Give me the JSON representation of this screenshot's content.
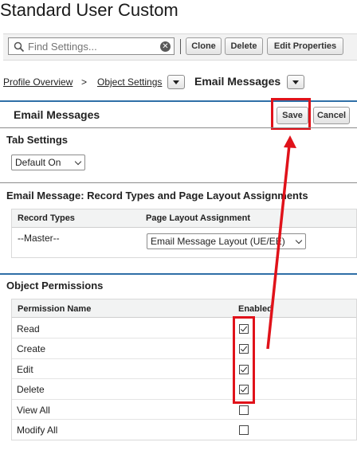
{
  "page_title": "Standard User Custom",
  "toolbar": {
    "search_placeholder": "Find Settings...",
    "clone_label": "Clone",
    "delete_label": "Delete",
    "edit_properties_label": "Edit Properties"
  },
  "breadcrumb": {
    "profile_overview": "Profile Overview",
    "separator": ">",
    "object_settings": "Object Settings",
    "current": "Email Messages"
  },
  "header": {
    "title": "Email Messages",
    "save_label": "Save",
    "cancel_label": "Cancel"
  },
  "tab_settings": {
    "title": "Tab Settings",
    "selected": "Default On"
  },
  "record_types": {
    "title": "Email Message: Record Types and Page Layout Assignments",
    "col_record_types": "Record Types",
    "col_page_layout": "Page Layout Assignment",
    "row_record_type": "--Master--",
    "row_layout": "Email Message Layout (UE/EE)"
  },
  "object_permissions": {
    "title": "Object Permissions",
    "col_permission": "Permission Name",
    "col_enabled": "Enabled",
    "rows": [
      {
        "name": "Read",
        "enabled": true
      },
      {
        "name": "Create",
        "enabled": true
      },
      {
        "name": "Edit",
        "enabled": true
      },
      {
        "name": "Delete",
        "enabled": true
      },
      {
        "name": "View All",
        "enabled": false
      },
      {
        "name": "Modify All",
        "enabled": false
      }
    ]
  },
  "annotation_color": "#e0121a"
}
